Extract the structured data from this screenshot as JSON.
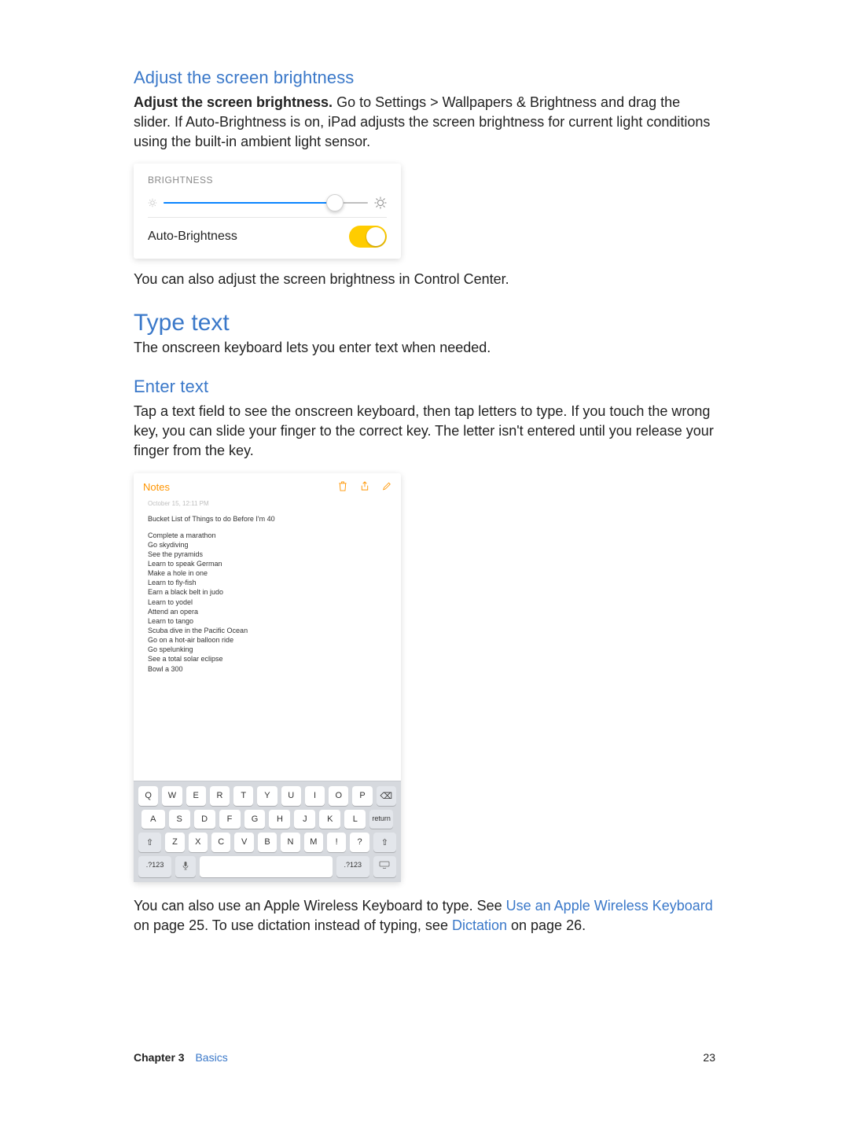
{
  "sections": {
    "brightness": {
      "heading": "Adjust the screen brightness",
      "lead_bold": "Adjust the screen brightness.",
      "lead_rest": " Go to Settings > Wallpapers & Brightness and drag the slider. If Auto-Brightness is on, iPad adjusts the screen brightness for current light conditions using the built-in ambient light sensor.",
      "card": {
        "label": "BRIGHTNESS",
        "auto_label": "Auto-Brightness"
      },
      "after": "You can also adjust the screen brightness in Control Center."
    },
    "typetext": {
      "heading": "Type text",
      "sub": "The onscreen keyboard lets you enter text when needed."
    },
    "enter": {
      "heading": "Enter text",
      "para": "Tap a text field to see the onscreen keyboard, then tap letters to type. If you touch the wrong key, you can slide your finger to the correct key. The letter isn't entered until you release your finger from the key."
    },
    "notes": {
      "back": "Notes",
      "meta": "October 15, 12:11 PM",
      "title": "Bucket List of Things to do Before I'm 40",
      "items": [
        "Complete a marathon",
        "Go skydiving",
        "See the pyramids",
        "Learn to speak German",
        "Make a hole in one",
        "Learn to fly-fish",
        "Earn a black belt in judo",
        "Learn to yodel",
        "Attend an opera",
        "Learn to tango",
        "Scuba dive in the Pacific Ocean",
        "Go on a hot-air balloon ride",
        "Go spelunking",
        "See a total solar eclipse",
        "Bowl a 300"
      ]
    },
    "keyboard": {
      "row1": [
        "Q",
        "W",
        "E",
        "R",
        "T",
        "Y",
        "U",
        "I",
        "O",
        "P"
      ],
      "row2": [
        "A",
        "S",
        "D",
        "F",
        "G",
        "H",
        "J",
        "K",
        "L"
      ],
      "row3": [
        "Z",
        "X",
        "C",
        "V",
        "B",
        "N",
        "M",
        "!",
        "?"
      ],
      "backspace": "⌫",
      "return": "return",
      "shift": "⇧",
      "mode": ".?123",
      "mic": "🎤",
      "hide": "⌨"
    },
    "closing": {
      "t1": "You can also use an Apple Wireless Keyboard to type. See ",
      "link1": "Use an Apple Wireless Keyboard",
      "t2": " on page 25. To use dictation instead of typing, see ",
      "link2": "Dictation",
      "t3": " on page 26."
    }
  },
  "footer": {
    "chapter": "Chapter  3",
    "section": "Basics",
    "page": "23"
  }
}
